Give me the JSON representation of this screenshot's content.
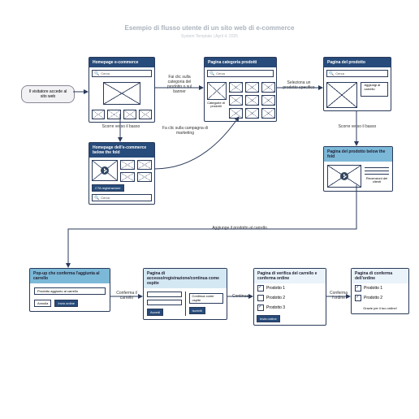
{
  "title": "Esempio di flusso utente di un sito web di e-commerce",
  "subtitle": "System Template | April 4, 2025",
  "entry": "Il visitatore accede al sito web",
  "search_label": "Cerca",
  "boxes": {
    "home": {
      "title": "Homepage e-commerce"
    },
    "home_below": {
      "title": "Homepage dell'e-commerce below the fold",
      "cta": "CTA registrazione"
    },
    "category": {
      "title": "Pagina categoria prodotti",
      "side": "Categorie di prodotti"
    },
    "product": {
      "title": "Pagina del prodotto",
      "cta": "Aggiungi al carrello"
    },
    "product_below": {
      "title": "Pagina del prodotto below the fold",
      "side": "Recensioni dei clienti"
    },
    "popup": {
      "title": "Pop-up che conferma l'aggiunta al carrello",
      "msg": "Prodotto aggiunto al carrello",
      "cancel": "Annulla",
      "submit": "Invia ordine"
    },
    "signin": {
      "title": "Pagina di accesso/registrazione/continua come ospite",
      "guest": "Continua come ospite",
      "login": "Accedi",
      "signup": "Iscriviti"
    },
    "cart": {
      "title": "Pagina di verifica del carrello e conferma ordine",
      "p1": "Prodotto 1",
      "p2": "Prodotto 2",
      "p3": "Prodotto 3",
      "submit": "Invia ordine"
    },
    "confirm": {
      "title": "Pagina di conferma dell'ordine",
      "p1": "Prodotto 1",
      "p2": "Prodotto 2",
      "thanks": "Grazie per il tuo ordine!"
    }
  },
  "labels": {
    "l1": "Fai clic sulla categoria del prodotto o sul banner",
    "l2": "Seleziona un prodotto specifico",
    "l3": "Scorre verso il basso",
    "l4": "Fa clic sulla campagna di marketing",
    "l5": "Scorre verso il basso",
    "l6": "Aggiunge il prodotto al carrello",
    "l7": "Conferma il carrello",
    "l8": "Continua",
    "l9": "Conferma l'ordine"
  }
}
